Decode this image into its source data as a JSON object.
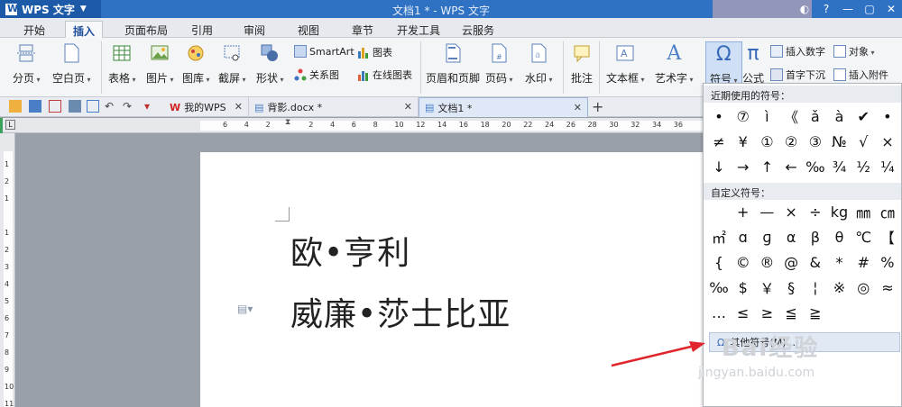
{
  "titlebar": {
    "app_name": "WPS 文字",
    "window_title": "文档1 * - WPS 文字"
  },
  "menu": {
    "tabs": [
      "开始",
      "插入",
      "页面布局",
      "引用",
      "审阅",
      "视图",
      "章节",
      "开发工具",
      "云服务"
    ],
    "active": "插入"
  },
  "ribbon": {
    "page_break": "分页",
    "blank_page": "空白页",
    "table": "表格",
    "picture": "图片",
    "gallery": "图库",
    "screenshot": "截屏",
    "shapes": "形状",
    "smartart": "SmartArt",
    "chart": "图表",
    "relation": "关系图",
    "online_chart": "在线图表",
    "header_footer": "页眉和页脚",
    "page_number": "页码",
    "watermark": "水印",
    "comment": "批注",
    "textbox": "文本框",
    "wordart": "艺术字",
    "symbol": "符号",
    "formula": "公式",
    "insert_number": "插入数字",
    "dropcap": "首字下沉",
    "object": "对象",
    "insert_attachment": "插入附件"
  },
  "doctabs": [
    {
      "label": "我的WPS",
      "active": false
    },
    {
      "label": "背影.docx *",
      "active": false
    },
    {
      "label": "文档1 *",
      "active": true
    }
  ],
  "ruler": {
    "ticks": [
      "6",
      "4",
      "2",
      "",
      "2",
      "4",
      "6",
      "8",
      "10",
      "12",
      "14",
      "16",
      "18",
      "20",
      "22",
      "24",
      "26",
      "28",
      "30",
      "32",
      "34",
      "36"
    ]
  },
  "vruler": {
    "ticks": [
      "1",
      "2",
      "1",
      "",
      "1",
      "2",
      "3",
      "4",
      "5",
      "6",
      "7",
      "8",
      "9",
      "10",
      "11",
      "12"
    ]
  },
  "document": {
    "lines": [
      "欧•亨利",
      "威廉•莎士比亚"
    ]
  },
  "symbol_panel": {
    "recent_header": "近期使用的符号：",
    "recent": [
      "•",
      "⑦",
      "ì",
      "《",
      "ǎ",
      "à",
      "✔",
      "•",
      "≠",
      "¥",
      "①",
      "②",
      "③",
      "№",
      "√",
      "×",
      "↓",
      "→",
      "↑",
      "←",
      "‰",
      "¾",
      "½",
      "¼"
    ],
    "custom_header": "自定义符号：",
    "custom": [
      "",
      "+",
      "—",
      "×",
      "÷",
      "kg",
      "㎜",
      "㎝",
      "㎡",
      "ɑ",
      "ɡ",
      "α",
      "β",
      "θ",
      "℃",
      "【",
      "{",
      "©",
      "®",
      "@",
      "&",
      "*",
      "#",
      "%",
      "‰",
      "$",
      "￥",
      "§",
      "¦",
      "※",
      "◎",
      "≈",
      "…",
      "≤",
      "≥",
      "≦",
      "≧",
      "",
      "",
      ""
    ],
    "more": "其他符号(M)..."
  },
  "watermark": {
    "brand": "Bai经验",
    "url": "jingyan.baidu.com"
  },
  "colors": {
    "titlebar": "#2f72c4",
    "accent": "#1f4f9a",
    "arrow": "#e0262c",
    "page": "#ffffff"
  }
}
